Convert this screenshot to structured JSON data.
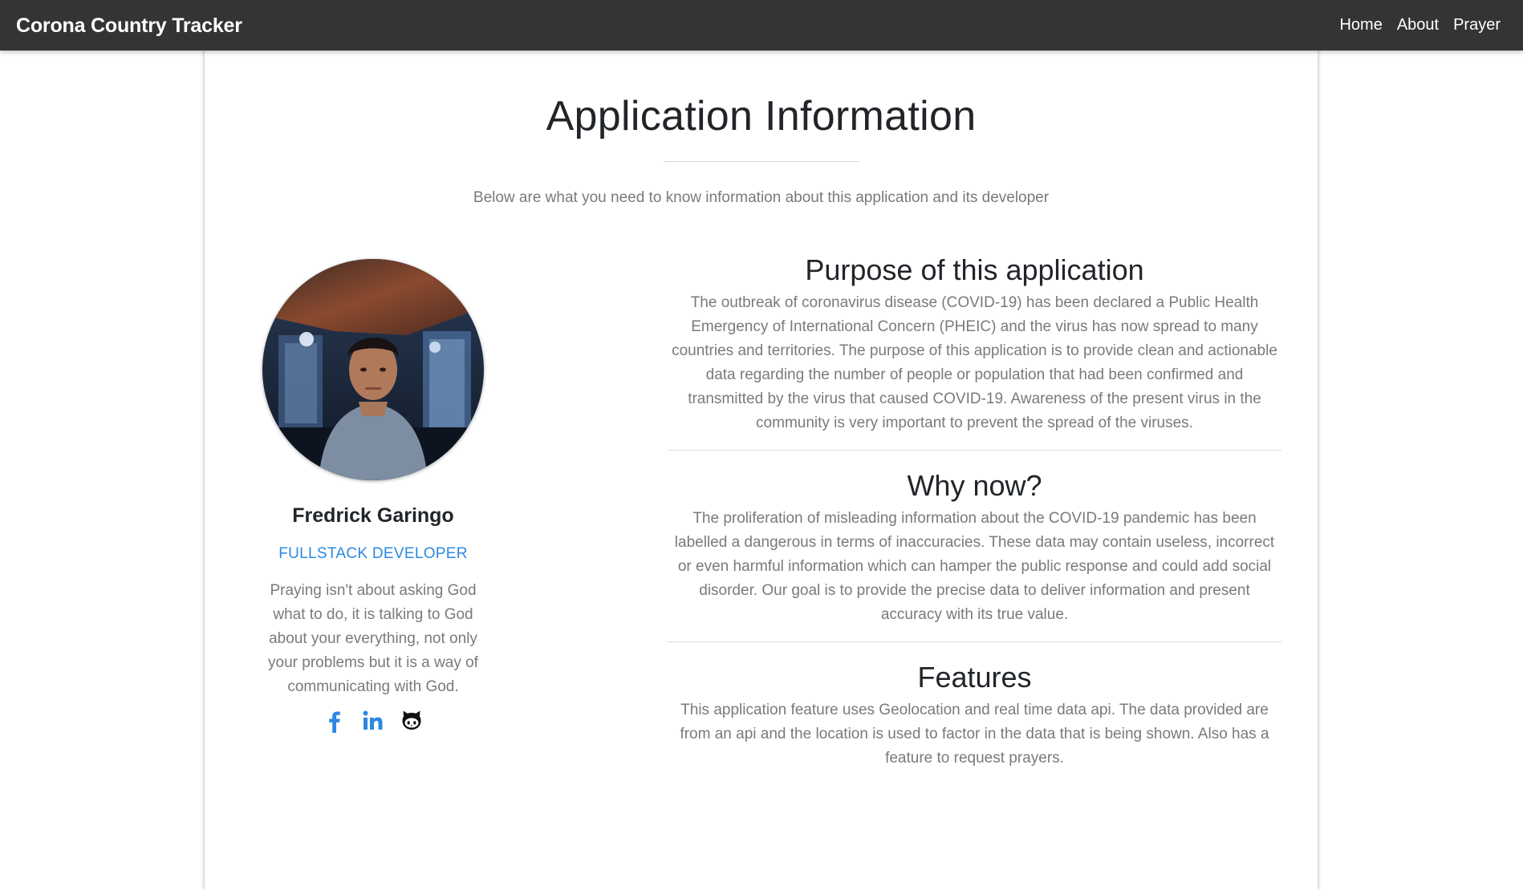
{
  "navbar": {
    "brand": "Corona Country Tracker",
    "links": [
      {
        "label": "Home"
      },
      {
        "label": "About"
      },
      {
        "label": "Prayer"
      }
    ]
  },
  "page": {
    "title": "Application Information",
    "subtitle": "Below are what you need to know information about this application and its developer"
  },
  "developer": {
    "name": "Fredrick Garingo",
    "role": "FULLSTACK DEVELOPER",
    "quote": "Praying isn't about asking God what to do, it is talking to God about your everything, not only your problems but it is a way of communicating with God.",
    "socials": [
      {
        "icon": "facebook-icon",
        "color": "#2c89e0"
      },
      {
        "icon": "linkedin-icon",
        "color": "#2c89e0"
      },
      {
        "icon": "github-icon",
        "color": "#111111"
      }
    ]
  },
  "sections": [
    {
      "heading": "Purpose of this application",
      "body": "The outbreak of coronavirus disease (COVID-19) has been declared a Public Health Emergency of International Concern (PHEIC) and the virus has now spread to many countries and territories. The purpose of this application is to provide clean and actionable data regarding the number of people or population that had been confirmed and transmitted by the virus that caused COVID-19. Awareness of the present virus in the community is very important to prevent the spread of the viruses."
    },
    {
      "heading": "Why now?",
      "body": "The proliferation of misleading information about the COVID-19 pandemic has been labelled a dangerous in terms of inaccuracies. These data may contain useless, incorrect or even harmful information which can hamper the public response and could add social disorder. Our goal is to provide the precise data to deliver information and present accuracy with its true value."
    },
    {
      "heading": "Features",
      "body": "This application feature uses Geolocation and real time data api. The data provided are from an api and the location is used to factor in the data that is being shown. Also has a feature to request prayers."
    }
  ],
  "colors": {
    "navbar_bg": "#343434",
    "accent": "#2c89e0",
    "muted_text": "#7a7a7a"
  }
}
